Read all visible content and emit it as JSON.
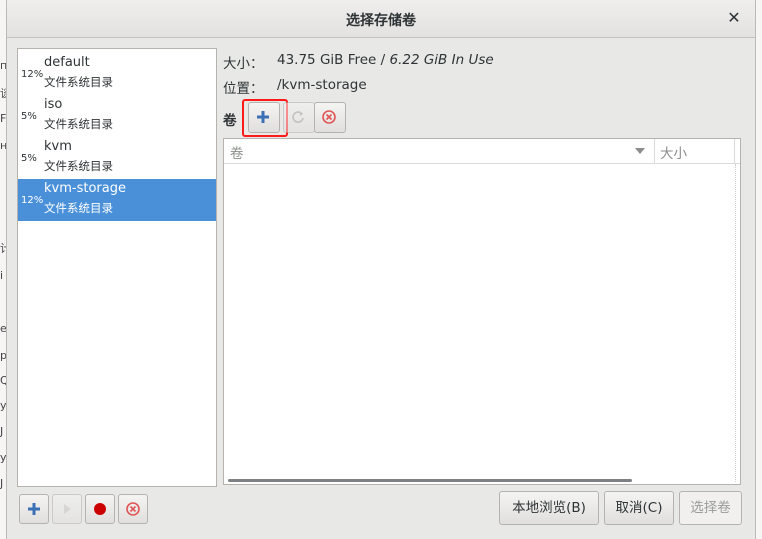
{
  "dialog": {
    "title": "选择存储卷"
  },
  "background_glyphs": [
    "п",
    "谈",
    "F",
    "н",
    "计",
    "i",
    "e",
    "p",
    "Q",
    "y",
    "J",
    "y",
    "J"
  ],
  "pools": [
    {
      "percent": "12%",
      "name": "default",
      "type": "文件系统目录",
      "selected": false
    },
    {
      "percent": "5%",
      "name": "iso",
      "type": "文件系统目录",
      "selected": false
    },
    {
      "percent": "5%",
      "name": "kvm",
      "type": "文件系统目录",
      "selected": false
    },
    {
      "percent": "12%",
      "name": "kvm-storage",
      "type": "文件系统目录",
      "selected": true
    }
  ],
  "info": {
    "size_label": "大小：",
    "size_free": "43.75 GiB Free",
    "size_sep": " / ",
    "size_used": "6.22 GiB In Use",
    "location_label": "位置：",
    "location_value": "/kvm-storage",
    "volumes_label": "卷"
  },
  "volume_table": {
    "columns": [
      "卷",
      "大小"
    ],
    "rows": []
  },
  "buttons": {
    "browse_local": "本地浏览(B)",
    "cancel": "取消(C)",
    "choose_volume": "选择卷"
  },
  "icons": {
    "add": "add-icon",
    "refresh": "refresh-icon",
    "delete": "delete-icon",
    "start": "play-icon",
    "stop": "stop-icon",
    "close": "close-icon"
  },
  "colors": {
    "selection": "#4a90d9",
    "add_icon": "#3b6fb6",
    "delete_icon": "#e05555",
    "stop_icon": "#cc0000",
    "highlight": "#ff1a1a"
  }
}
